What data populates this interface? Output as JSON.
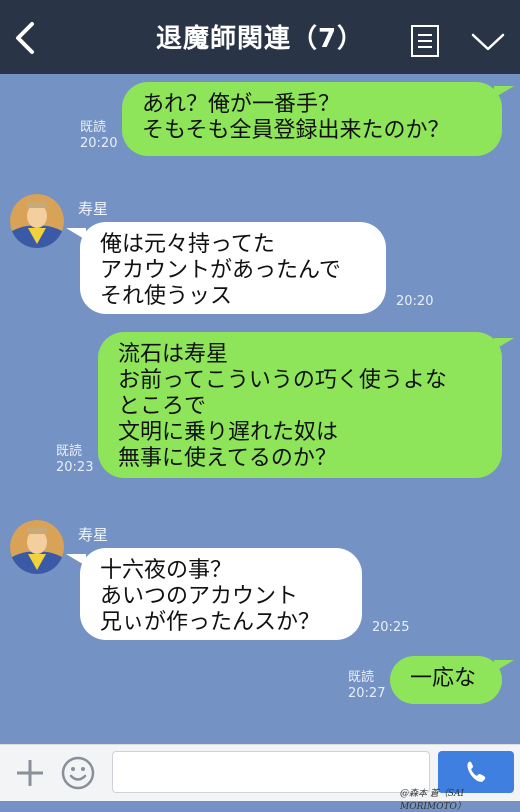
{
  "header": {
    "title": "退魔師関連（7）",
    "back_icon": "chevron-left-icon",
    "menu_icon": "notes-icon",
    "expand_icon": "chevron-down-icon"
  },
  "colors": {
    "header_bg": "#293546",
    "chat_bg": "#7493c4",
    "outgoing_bubble": "#8ee55a",
    "incoming_bubble": "#ffffff",
    "call_button": "#3f7fe0"
  },
  "messages": [
    {
      "direction": "out",
      "text": "あれ？俺が一番手？\nそもそも全員登録出来たのか？",
      "read": "既読",
      "time": "20:20"
    },
    {
      "direction": "in",
      "sender": "寿星",
      "text": "俺は元々持ってた\nアカウントがあったんで\nそれ使うッス",
      "time": "20:20"
    },
    {
      "direction": "out",
      "text": "流石は寿星\nお前ってこういうの巧く使うよな\nところで\n文明に乗り遅れた奴は\n無事に使えてるのか？",
      "read": "既読",
      "time": "20:23"
    },
    {
      "direction": "in",
      "sender": "寿星",
      "text": "十六夜の事？\nあいつのアカウント\n兄ぃが作ったんスか？",
      "time": "20:25"
    },
    {
      "direction": "out",
      "text": "一応な",
      "read": "既読",
      "time": "20:27"
    }
  ],
  "footer": {
    "plus_icon": "plus-icon",
    "sticker_icon": "smiley-icon",
    "input_value": "",
    "call_icon": "phone-icon"
  },
  "watermark": "@森本 蒼（SAI MORIMOTO）"
}
